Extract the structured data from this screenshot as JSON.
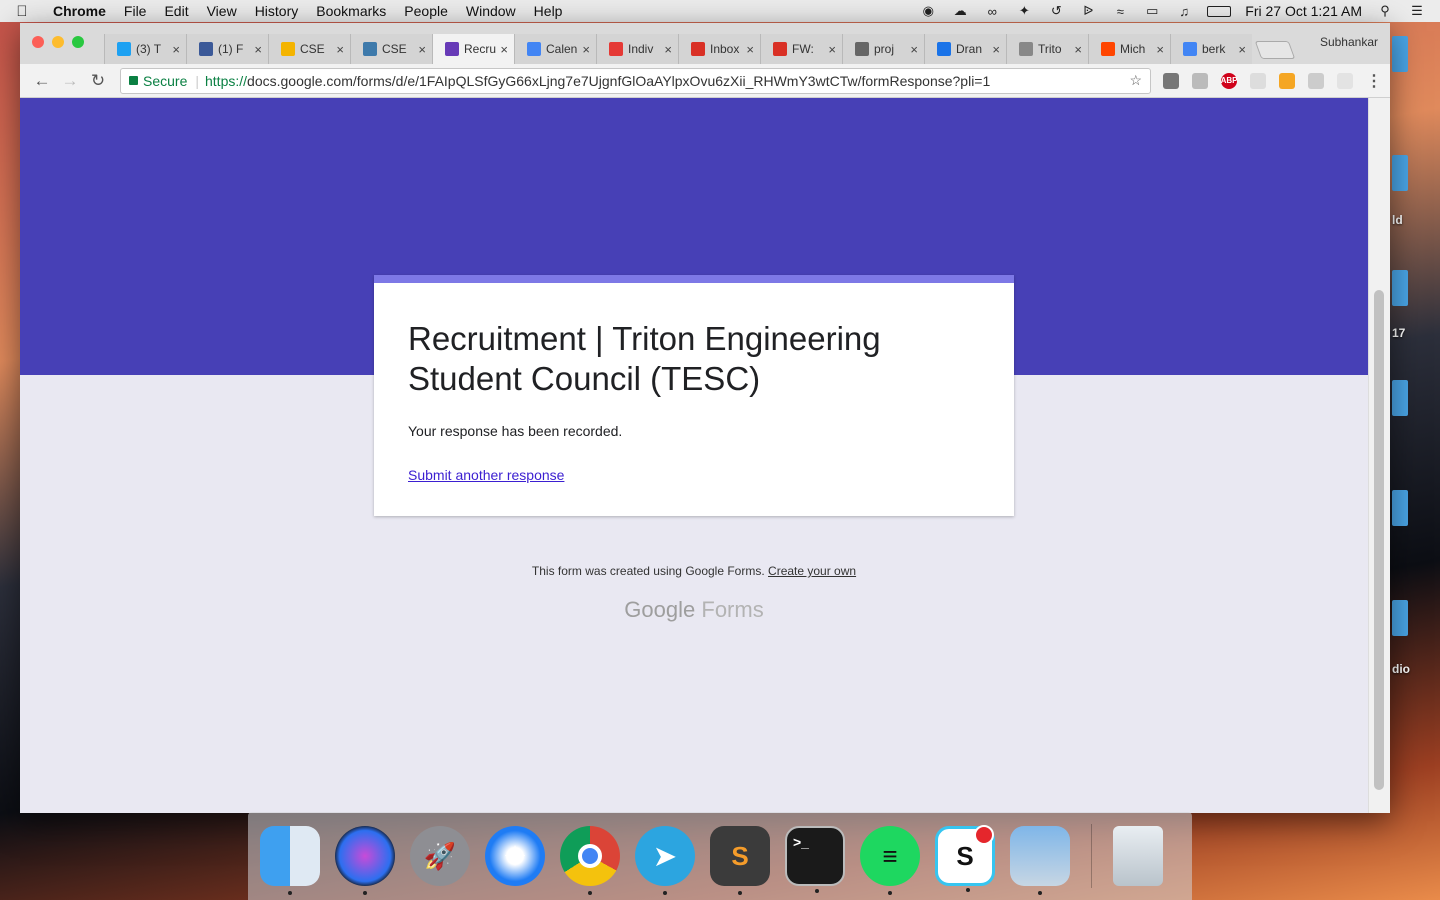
{
  "menubar": {
    "app": "Chrome",
    "items": [
      "File",
      "Edit",
      "View",
      "History",
      "Bookmarks",
      "People",
      "Window",
      "Help"
    ],
    "datetime": "Fri 27 Oct  1:21 AM"
  },
  "desktop": {
    "labels": [
      "ld",
      "17",
      "dio"
    ]
  },
  "browser": {
    "profile": "Subhankar",
    "tabs": [
      {
        "title": "(3) T",
        "icon": "twitter-icon",
        "color": "#1da1f2"
      },
      {
        "title": "(1) F",
        "icon": "facebook-icon",
        "color": "#3b5998"
      },
      {
        "title": "CSE",
        "icon": "google-drive-icon",
        "color": "#f4b400"
      },
      {
        "title": "CSE",
        "icon": "piazza-icon",
        "color": "#3e7aab"
      },
      {
        "title": "Recru",
        "icon": "google-forms-icon",
        "color": "#673ab7"
      },
      {
        "title": "Calen",
        "icon": "calendar-icon",
        "color": "#4285f4"
      },
      {
        "title": "Indiv",
        "icon": "pdf-icon",
        "color": "#e53935"
      },
      {
        "title": "Inbox",
        "icon": "gmail-icon",
        "color": "#d93025"
      },
      {
        "title": "FW:",
        "icon": "gmail-icon",
        "color": "#d93025"
      },
      {
        "title": "proj",
        "icon": "tex-icon",
        "color": "#666666"
      },
      {
        "title": "Dran",
        "icon": "drawing-icon",
        "color": "#1a73e8"
      },
      {
        "title": "Trito",
        "icon": "document-icon",
        "color": "#888888"
      },
      {
        "title": "Mich",
        "icon": "reddit-icon",
        "color": "#ff4500"
      },
      {
        "title": "berk",
        "icon": "google-icon",
        "color": "#4285f4"
      }
    ],
    "active_tab_index": 4,
    "secure_label": "Secure",
    "url_scheme": "https://",
    "url_rest": "docs.google.com/forms/d/e/1FAIpQLSfGyG66xLjng7e7UjgnfGlOaAYlpxOvu6zXii_RHWmY3wtCTw/formResponse?pli=1"
  },
  "form": {
    "title": "Recruitment | Triton Engineering Student Council (TESC)",
    "confirmation": "Your response has been recorded.",
    "submit_another": "Submit another response",
    "footer_text": "This form was created using Google Forms.",
    "footer_link": "Create your own",
    "brand_google": "Google",
    "brand_forms": "Forms"
  },
  "colors": {
    "banner": "#4740b6",
    "card_accent": "#7d78e6",
    "page_bg": "#e9e8f2",
    "link": "#3b1fd1"
  },
  "dock": {
    "apps": [
      "Finder",
      "Siri",
      "Launchpad",
      "Safari",
      "Chrome",
      "Telegram",
      "Sublime Text",
      "Terminal",
      "Spotify",
      "Slack",
      "Preview",
      "Trash"
    ]
  }
}
